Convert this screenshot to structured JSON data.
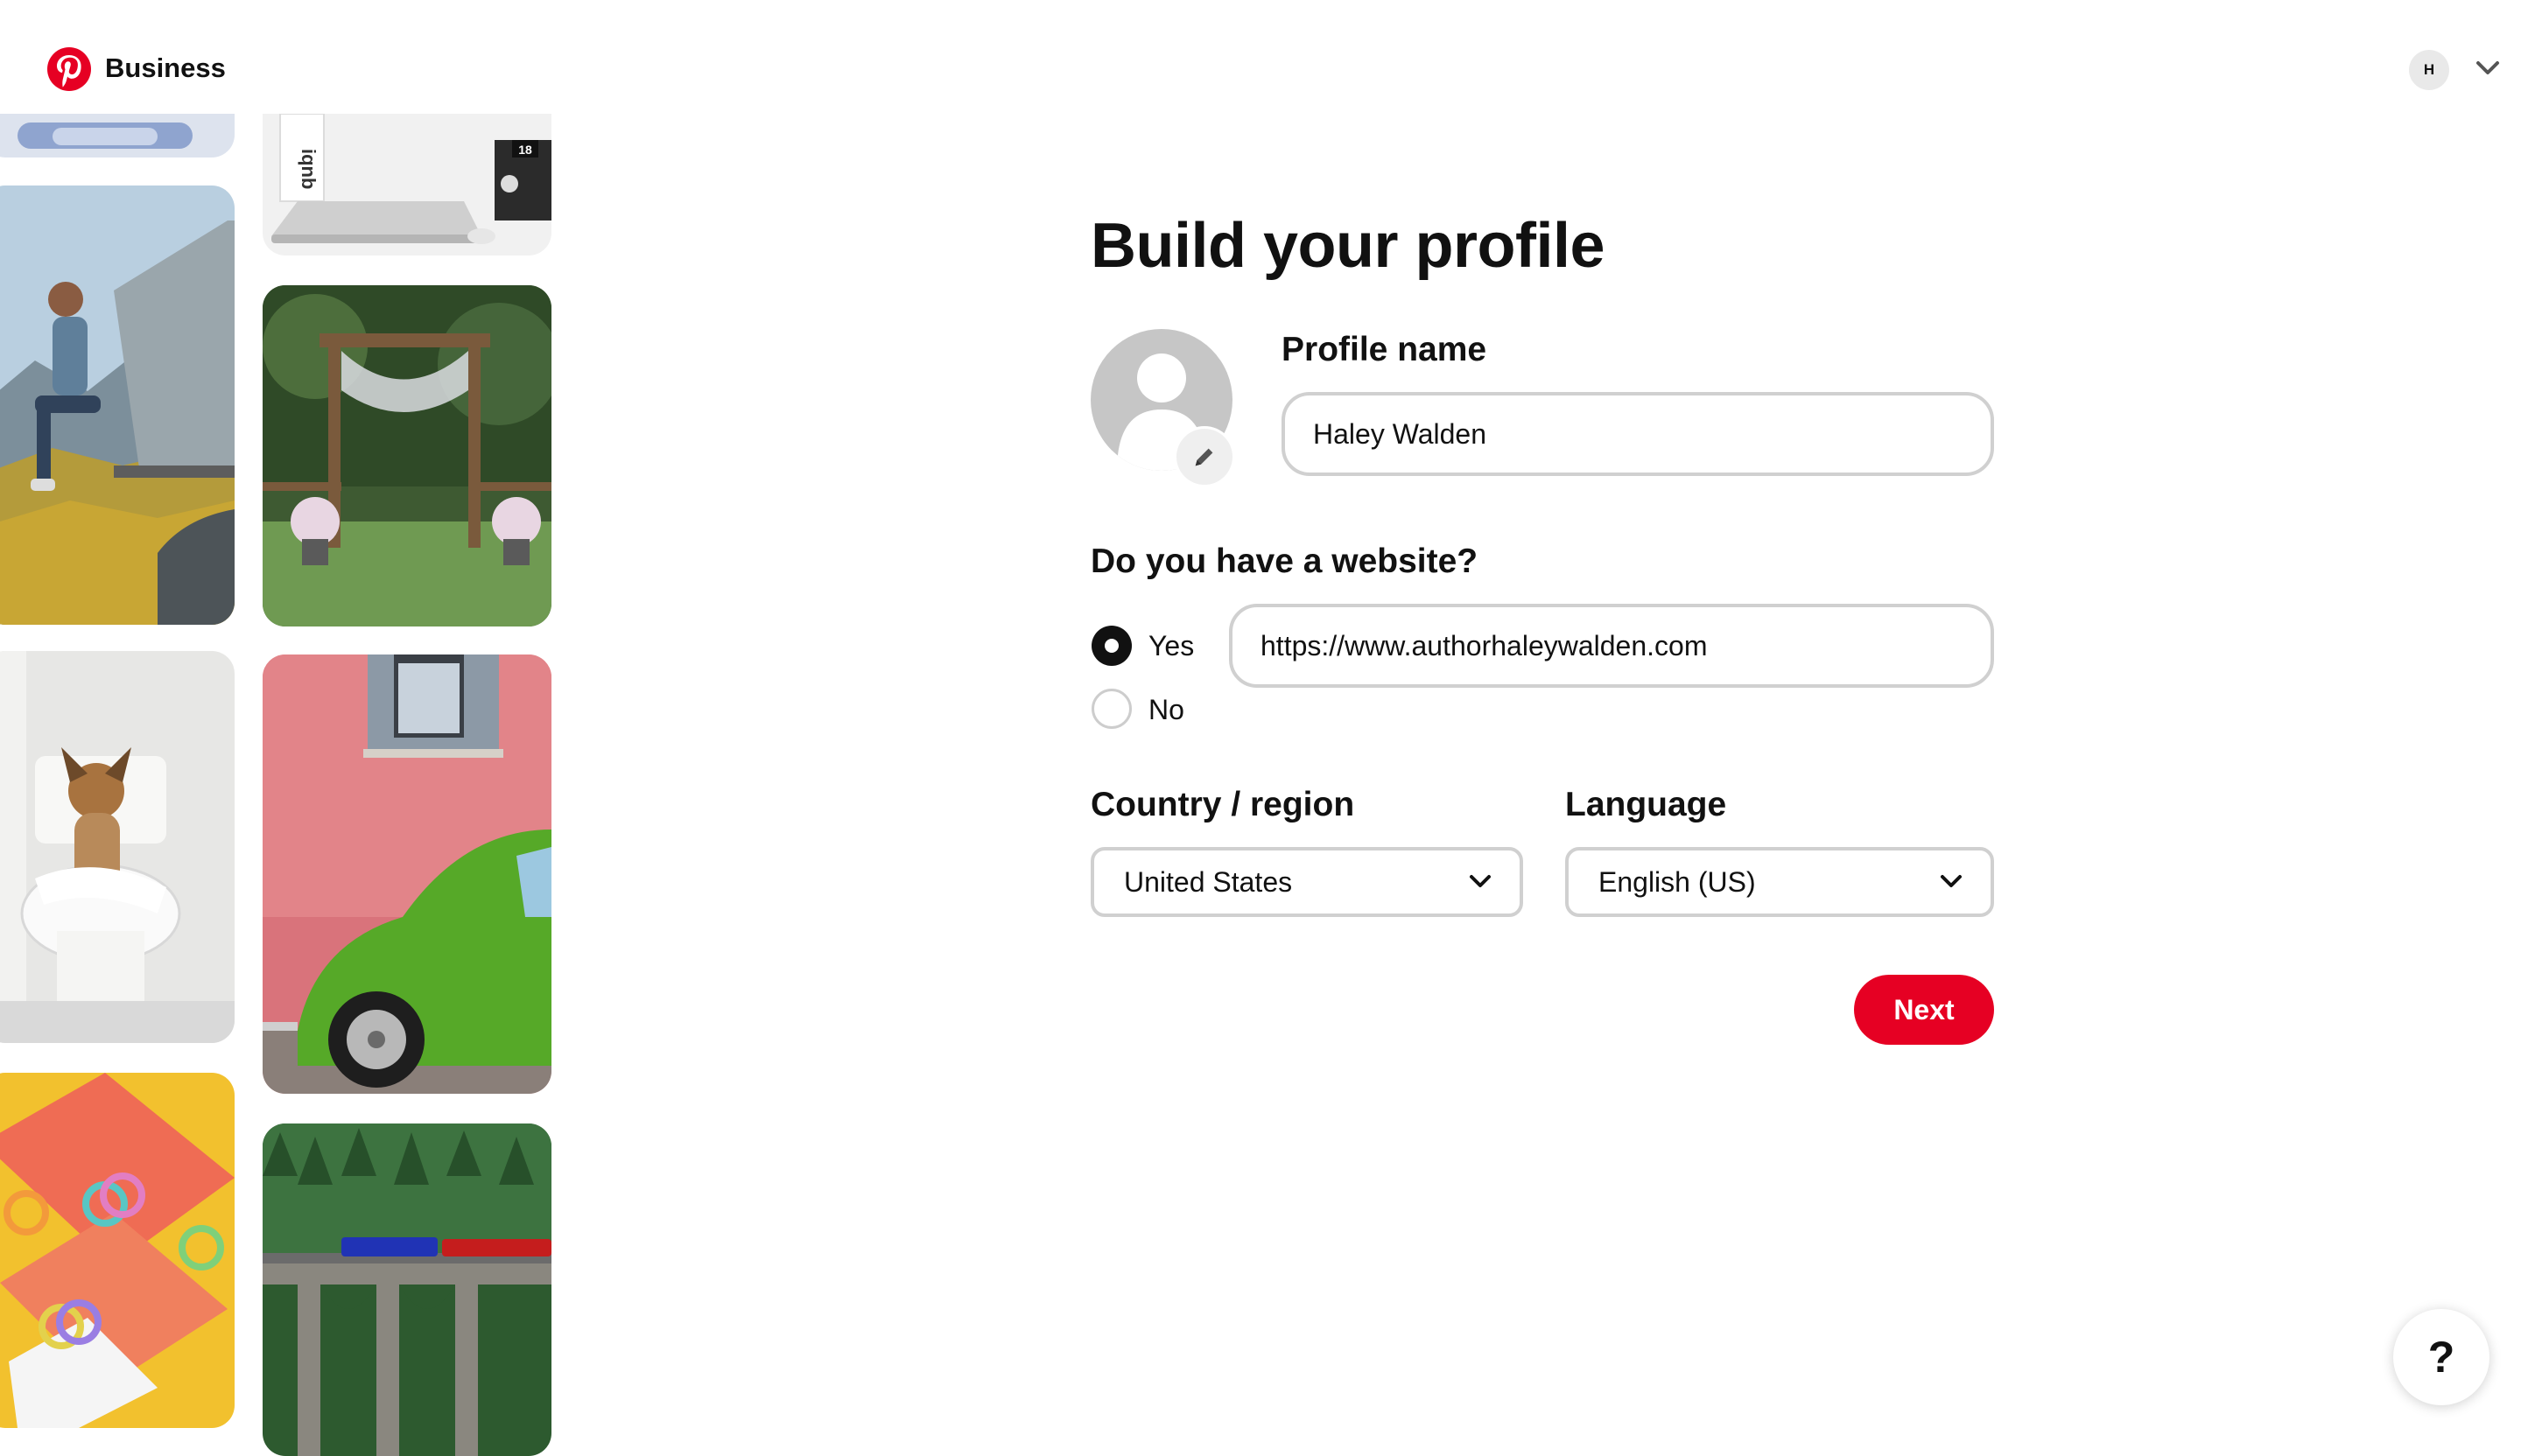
{
  "header": {
    "brand": "Business",
    "account_initial": "H"
  },
  "colors": {
    "brand_red": "#e60023",
    "input_border": "#d0d0d0",
    "text": "#111111"
  },
  "icons": {
    "logo": "pinterest-logo-icon",
    "account_menu": "chevron-down-icon",
    "edit_photo": "pencil-icon",
    "select_arrow": "chevron-down-icon"
  },
  "collage": {
    "tiles": [
      "blue-object-top",
      "laptop-desk",
      "man-on-rooftop-tent",
      "wedding-arch-garden",
      "dog-on-toilet",
      "pink-wall-green-beetle",
      "rainbow-slinkies-yellow",
      "train-on-viaduct-forest"
    ],
    "laptop_box_text": "iqnb",
    "laptop_badge": "18"
  },
  "form": {
    "title": "Build your profile",
    "profile_name_label": "Profile name",
    "profile_name_value": "Haley Walden",
    "website_question": "Do you have a website?",
    "website_yes": "Yes",
    "website_no": "No",
    "website_selected": "Yes",
    "website_value": "https://www.authorhaleywalden.com",
    "country_label": "Country / region",
    "country_value": "United States",
    "language_label": "Language",
    "language_value": "English (US)",
    "next_label": "Next"
  },
  "help": {
    "label": "?"
  }
}
